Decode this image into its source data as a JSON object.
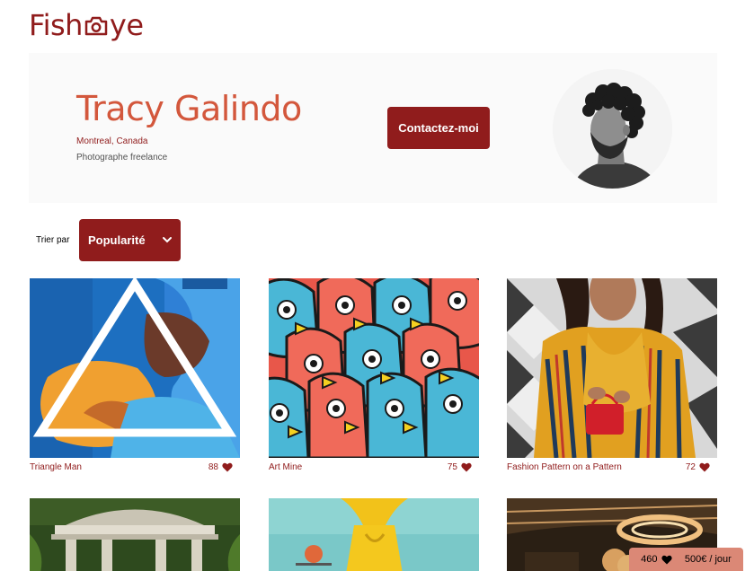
{
  "header": {
    "logo_text_left": "Fish",
    "logo_text_right": "ye",
    "logo_icon": "camera-icon"
  },
  "photographer": {
    "name": "Tracy Galindo",
    "location": "Montreal, Canada",
    "tagline": "Photographe freelance",
    "contact_label": "Contactez-moi"
  },
  "sort": {
    "label": "Trier par",
    "selected": "Popularité"
  },
  "media": [
    {
      "title": "Triangle Man",
      "likes": "88"
    },
    {
      "title": "Art Mine",
      "likes": "75"
    },
    {
      "title": "Fashion Pattern on a Pattern",
      "likes": "72"
    }
  ],
  "footer": {
    "total_likes": "460",
    "price": "500€ / jour"
  },
  "colors": {
    "primary": "#901c1c",
    "secondary": "#d3573c",
    "footer_bg": "#db8876",
    "banner_bg": "#fafafa"
  }
}
